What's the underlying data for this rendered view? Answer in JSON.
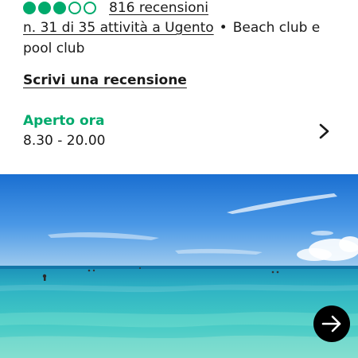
{
  "rating": {
    "bubbles_filled": 3,
    "bubbles_total": 5,
    "review_count_label": "816 recensioni",
    "color": "#00aa6c"
  },
  "ranking": {
    "label": "n. 31 di 35 attività a Ugento",
    "separator": "•",
    "category": "Beach club e pool club"
  },
  "write_review": {
    "label": "Scrivi una recensione"
  },
  "hours": {
    "status": "Aperto ora",
    "time": "8.30 - 20.00",
    "icon": "chevron-right-icon"
  },
  "photo": {
    "subject": "beach-sea-photo",
    "next_icon": "arrow-right-icon"
  }
}
